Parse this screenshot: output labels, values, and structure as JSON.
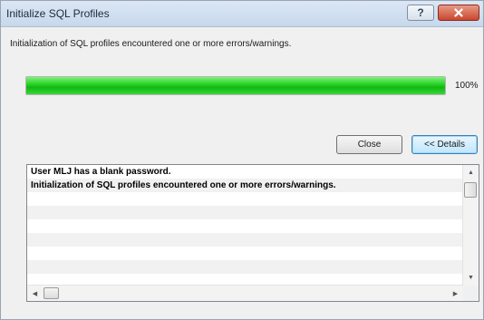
{
  "window": {
    "title": "Initialize SQL Profiles",
    "help_label": "?",
    "close_icon": "close-icon"
  },
  "message": "Initialization of SQL profiles encountered one or more errors/warnings.",
  "progress": {
    "percent": 100,
    "label": "100%",
    "fill_color": "#1fc51e"
  },
  "buttons": {
    "close_label": "Close",
    "details_label": "<< Details"
  },
  "log": {
    "rows": [
      "User MLJ has a blank password.",
      "Initialization of SQL profiles encountered one or more errors/warnings.",
      "",
      "",
      "",
      "",
      "",
      "",
      ""
    ],
    "scroll_up_icon": "scroll-up-arrow-icon",
    "scroll_down_icon": "scroll-down-arrow-icon",
    "scroll_left_icon": "scroll-left-arrow-icon",
    "scroll_right_icon": "scroll-right-arrow-icon"
  }
}
